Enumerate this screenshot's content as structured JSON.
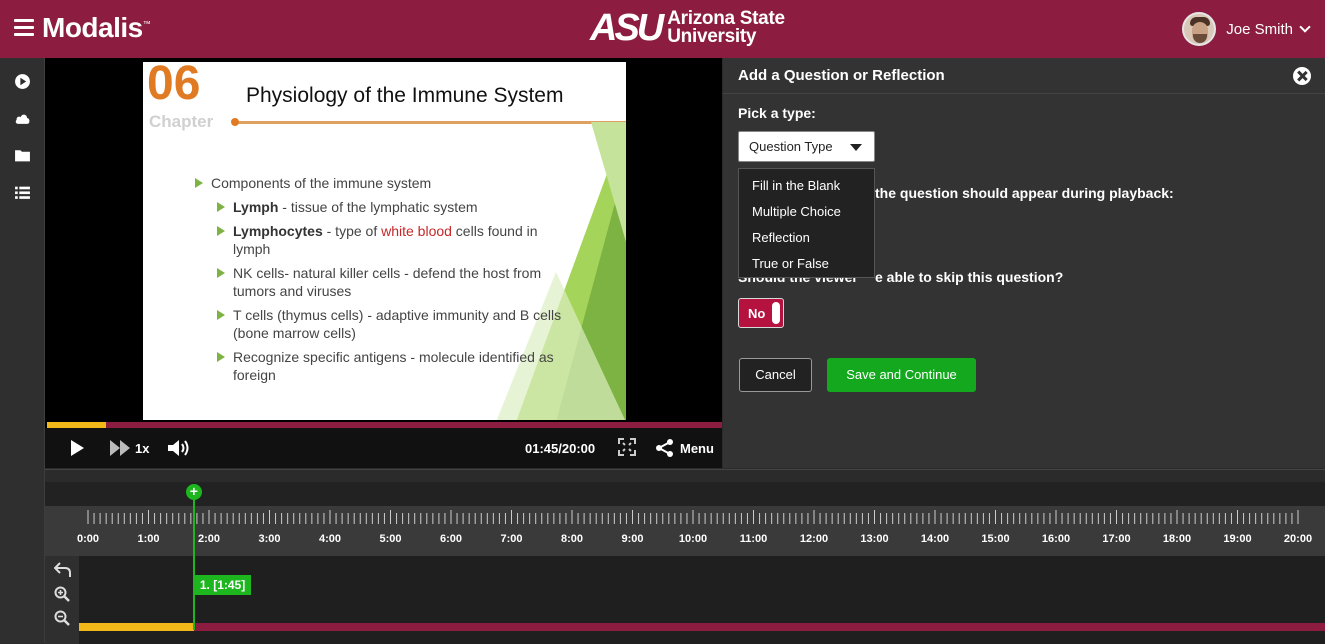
{
  "header": {
    "brand": "Modalis",
    "brand_tm": "™",
    "university_mark": "ASU",
    "university_name_line1": "Arizona State",
    "university_name_line2": "University",
    "user_name": "Joe Smith"
  },
  "leftnav": {
    "items": [
      "play-circle-icon",
      "cloud-icon",
      "folder-icon",
      "list-icon"
    ]
  },
  "slide": {
    "chapter_number": "06",
    "chapter_label": "Chapter",
    "title": "Physiology of the Immune System",
    "bullet_main": "Components of the immune system",
    "b1_bold": "Lymph",
    "b1_rest": " - tissue of the lymphatic system",
    "b2_bold": "Lymphocytes",
    "b2_mid": " - type of ",
    "b2_red": "white blood",
    "b2_rest": " cells found in lymph",
    "b3": "NK cells- natural killer cells - defend the host from tumors and viruses",
    "b4": "T cells (thymus cells) - adaptive immunity and B cells (bone marrow cells)",
    "b5": "Recognize specific antigens - molecule identified as foreign"
  },
  "player": {
    "progress_fraction": 0.0875,
    "speed": "1x",
    "time": "01:45/20:00",
    "menu_label": "Menu"
  },
  "panel": {
    "title": "Add a Question or Reflection",
    "pick_type_label": "Pick a type:",
    "select_value": "Question Type",
    "options": [
      "Fill in the Blank",
      "Multiple Choice",
      "Reflection",
      "True or False"
    ],
    "appear_label": "the question should appear during playback:",
    "skip_label_visible_start": "Should the viewer",
    "skip_label_visible_end": "e able to skip this question?",
    "toggle_value": "No",
    "cancel_label": "Cancel",
    "save_label": "Save and Continue"
  },
  "timeline": {
    "labels": [
      "0:00",
      "1:00",
      "2:00",
      "3:00",
      "4:00",
      "5:00",
      "6:00",
      "7:00",
      "8:00",
      "9:00",
      "10:00",
      "11:00",
      "12:00",
      "13:00",
      "14:00",
      "15:00",
      "16:00",
      "17:00",
      "18:00",
      "19:00",
      "20:00"
    ],
    "marker_label": "1. [1:45]",
    "progress_fraction": 0.0875
  },
  "colors": {
    "maroon": "#8c1d40",
    "gold": "#f2b81a",
    "green": "#1db61f"
  }
}
